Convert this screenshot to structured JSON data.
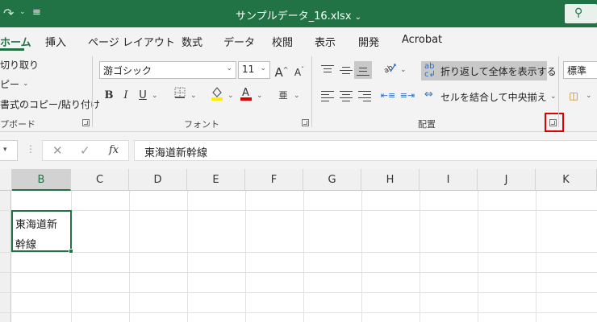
{
  "titlebar": {
    "title": "サンプルデータ_16.xlsx",
    "title_caret": "⌄",
    "search_icon": "⚲"
  },
  "tabs": [
    {
      "label": "ホーム",
      "active": true
    },
    {
      "label": "挿入"
    },
    {
      "label": "ページ レイアウト"
    },
    {
      "label": "数式"
    },
    {
      "label": "データ"
    },
    {
      "label": "校閲"
    },
    {
      "label": "表示"
    },
    {
      "label": "開発"
    },
    {
      "label": "Acrobat"
    }
  ],
  "clipboard": {
    "cut": "切り取り",
    "copy": "ピー",
    "format_painter": "書式のコピー/貼り付け",
    "group_label": "プボード"
  },
  "font": {
    "font_name": "游ゴシック",
    "font_size": "11",
    "grow_glyph": "A",
    "shrink_glyph": "A",
    "bold": "B",
    "italic": "I",
    "underline": "U",
    "phonetic": "亜",
    "group_label": "フォント"
  },
  "alignment": {
    "wrap_text": "折り返して全体を表示する",
    "merge_center": "セルを結合して中央揃え",
    "group_label": "配置"
  },
  "number": {
    "format": "標準"
  },
  "formula_bar": {
    "cancel": "✕",
    "enter": "✓",
    "fx": "fx",
    "content": "東海道新幹線"
  },
  "columns": [
    "B",
    "C",
    "D",
    "E",
    "F",
    "G",
    "H",
    "I",
    "J",
    "K"
  ],
  "selected_column": "B",
  "active_cell": {
    "text": "東海道新\n幹線"
  },
  "colors": {
    "accent": "#217346",
    "highlight_box": "#e00000",
    "font_color_bar": "#e00000",
    "fill_color_bar": "#ffee00"
  }
}
